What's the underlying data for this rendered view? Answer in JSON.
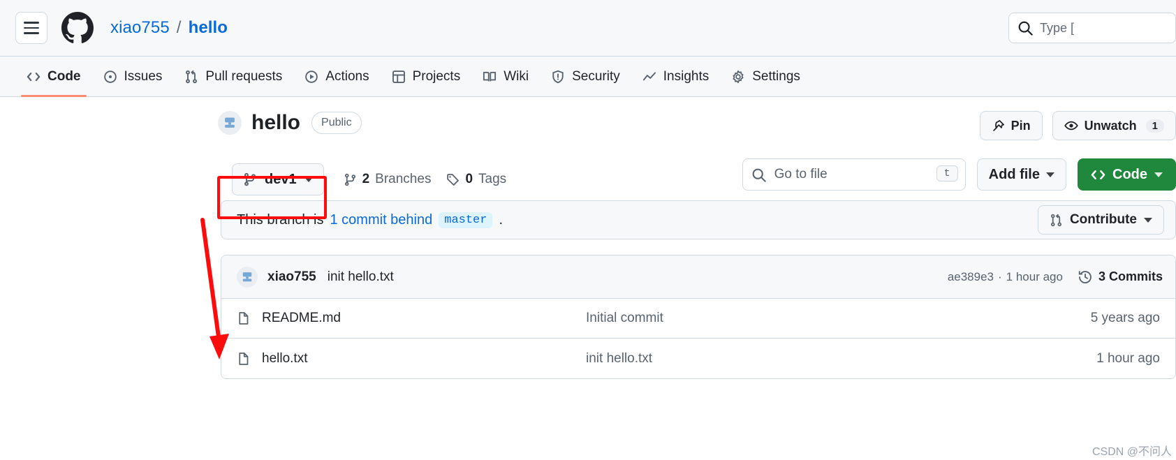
{
  "header": {
    "menu_icon": "hamburger-icon",
    "logo_icon": "github-mark-icon",
    "owner": "xiao755",
    "separator": "/",
    "repo": "hello",
    "search_icon": "search-icon",
    "search_placeholder": "Type ["
  },
  "nav": {
    "items": [
      {
        "label": "Code",
        "icon": "code-icon",
        "selected": true
      },
      {
        "label": "Issues",
        "icon": "issue-opened-icon",
        "selected": false
      },
      {
        "label": "Pull requests",
        "icon": "git-pull-request-icon",
        "selected": false
      },
      {
        "label": "Actions",
        "icon": "play-icon",
        "selected": false
      },
      {
        "label": "Projects",
        "icon": "table-icon",
        "selected": false
      },
      {
        "label": "Wiki",
        "icon": "book-icon",
        "selected": false
      },
      {
        "label": "Security",
        "icon": "shield-icon",
        "selected": false
      },
      {
        "label": "Insights",
        "icon": "graph-icon",
        "selected": false
      },
      {
        "label": "Settings",
        "icon": "gear-icon",
        "selected": false
      }
    ]
  },
  "repo": {
    "avatar_icon": "repo-avatar-icon",
    "name": "hello",
    "visibility": "Public",
    "pin_label": "Pin",
    "pin_icon": "pin-icon",
    "watch_label": "Unwatch",
    "watch_icon": "eye-icon",
    "watch_count": "1"
  },
  "filenav": {
    "branch": "dev1",
    "branch_icon": "git-branch-icon",
    "branches_count": "2",
    "branches_label": "Branches",
    "tags_count": "0",
    "tags_label": "Tags",
    "tag_icon": "tag-icon",
    "search_placeholder": "Go to file",
    "search_icon": "search-icon",
    "search_kbd": "t",
    "add_file_label": "Add file",
    "code_label": "Code",
    "code_icon": "code-icon"
  },
  "banner": {
    "prefix": "This branch is",
    "link": "1 commit behind",
    "base_branch": "master",
    "suffix": ".",
    "contribute_label": "Contribute",
    "contribute_icon": "git-pull-request-icon"
  },
  "commit_bar": {
    "avatar_icon": "user-avatar-icon",
    "author": "xiao755",
    "message": "init hello.txt",
    "sha": "ae389e3",
    "dot": "·",
    "time": "1 hour ago",
    "history_icon": "history-icon",
    "commits_count": "3 Commits"
  },
  "files": {
    "rows": [
      {
        "icon": "file-icon",
        "name": "README.md",
        "message": "Initial commit",
        "age": "5 years ago"
      },
      {
        "icon": "file-icon",
        "name": "hello.txt",
        "message": "init hello.txt",
        "age": "1 hour ago"
      }
    ]
  },
  "annotation": {
    "rect_color": "#fb0d0d",
    "arrow_color": "#fb0d0d"
  },
  "watermark": "CSDN @不问人",
  "colors": {
    "accent_green": "#1f883d",
    "link_blue": "#0969da",
    "tab_underline": "#fd8c73",
    "surface": "#f6f8fa",
    "border": "#d1d9e0"
  }
}
